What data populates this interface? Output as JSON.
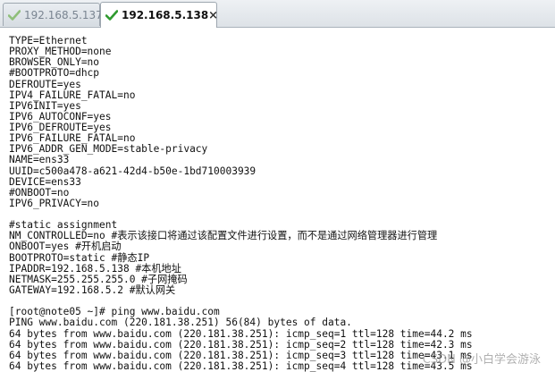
{
  "tabs": [
    {
      "label": "192.168.5.137",
      "active": false,
      "icon": "check-icon",
      "icon_color": "#8fbf7a"
    },
    {
      "label": "192.168.5.138",
      "active": true,
      "icon": "check-icon",
      "icon_color": "#2e9a2e",
      "close_label": "×"
    }
  ],
  "terminal": {
    "lines": [
      "TYPE=Ethernet",
      "PROXY_METHOD=none",
      "BROWSER_ONLY=no",
      "#BOOTPROTO=dhcp",
      "DEFROUTE=yes",
      "IPV4_FAILURE_FATAL=no",
      "IPV6INIT=yes",
      "IPV6_AUTOCONF=yes",
      "IPV6_DEFROUTE=yes",
      "IPV6_FAILURE_FATAL=no",
      "IPV6_ADDR_GEN_MODE=stable-privacy",
      "NAME=ens33",
      "UUID=c500a478-a621-42d4-b50e-1bd710003939",
      "DEVICE=ens33",
      "#ONBOOT=no",
      "IPV6_PRIVACY=no",
      "",
      "#static assignment",
      "NM_CONTROLLED=no #表示该接口将通过该配置文件进行设置，而不是通过网络管理器进行管理",
      "ONBOOT=yes #开机启动",
      "BOOTPROTO=static #静态IP",
      "IPADDR=192.168.5.138 #本机地址",
      "NETMASK=255.255.255.0 #子网掩码",
      "GATEWAY=192.168.5.2 #默认网关",
      "",
      "[root@note05 ~]# ping www.baidu.com",
      "PING www.baidu.com (220.181.38.251) 56(84) bytes of data.",
      "64 bytes from www.baidu.com (220.181.38.251): icmp_seq=1 ttl=128 time=44.2 ms",
      "64 bytes from www.baidu.com (220.181.38.251): icmp_seq=2 ttl=128 time=42.3 ms",
      "64 bytes from www.baidu.com (220.181.38.251): icmp_seq=3 ttl=128 time=43.1 ms",
      "64 bytes from www.baidu.com (220.181.38.251): icmp_seq=4 ttl=128 time=43.5 ms"
    ]
  },
  "watermark": "CSDN @小白学会游泳",
  "colors": {
    "terminal_text": "#111111",
    "terminal_bg": "#ffffff",
    "tab_inactive_text": "#7a8591"
  }
}
